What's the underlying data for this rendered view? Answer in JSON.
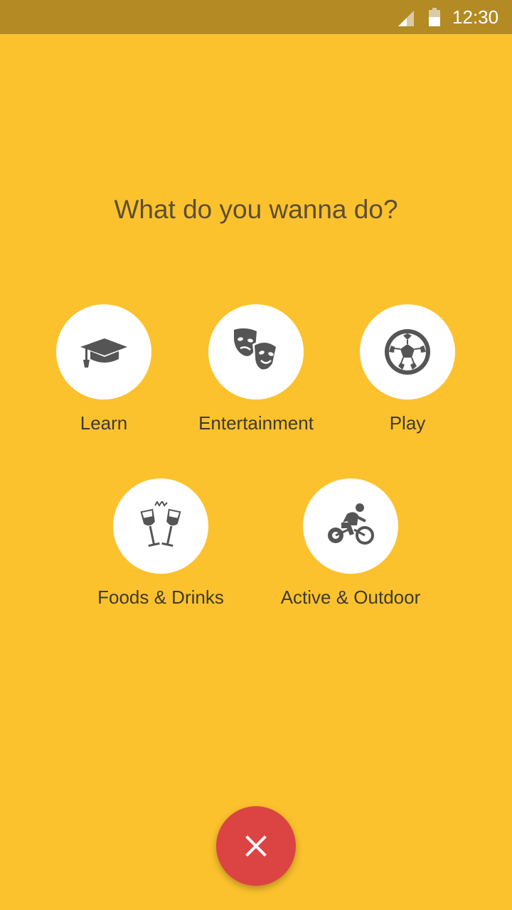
{
  "status_bar": {
    "time": "12:30",
    "icons": [
      "signal-icon",
      "battery-icon"
    ]
  },
  "prompt": {
    "title": "What do you wanna do?"
  },
  "categories": [
    {
      "label": "Learn",
      "icon": "graduation-cap-icon"
    },
    {
      "label": "Entertainment",
      "icon": "theater-masks-icon"
    },
    {
      "label": "Play",
      "icon": "soccer-ball-icon"
    },
    {
      "label": "Foods & Drinks",
      "icon": "champagne-glasses-icon"
    },
    {
      "label": "Active & Outdoor",
      "icon": "cyclist-icon"
    }
  ],
  "fab": {
    "icon": "close-icon"
  },
  "colors": {
    "background": "#FCC22D",
    "status_bar": "#B38A23",
    "icon": "#555555",
    "fab": "#DC4343",
    "circle": "#FFFFFF"
  }
}
